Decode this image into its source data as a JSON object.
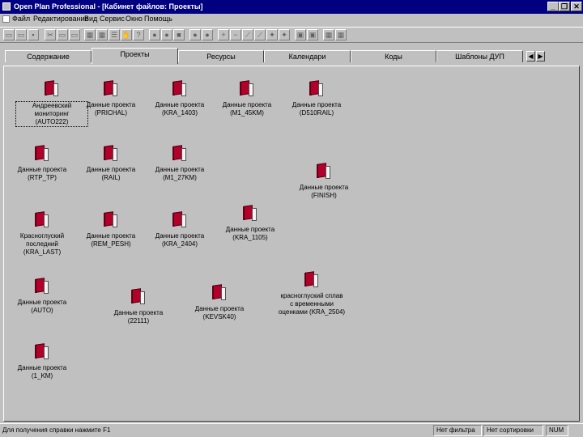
{
  "window": {
    "title": "Open Plan Professional - [Кабинет файлов: Проекты]",
    "minimize_glyph": "_",
    "restore_glyph": "❐",
    "close_glyph": "✕"
  },
  "menu": [
    {
      "label": "Файл"
    },
    {
      "label": "Редактирование"
    },
    {
      "label": "Вид"
    },
    {
      "label": "Сервис"
    },
    {
      "label": "Окно"
    },
    {
      "label": "Помощь"
    }
  ],
  "tabs": [
    {
      "label": "Содержание"
    },
    {
      "label": "Проекты",
      "active": true
    },
    {
      "label": "Ресурсы"
    },
    {
      "label": "Календари"
    },
    {
      "label": "Коды"
    },
    {
      "label": "Шаблоны ДУП"
    }
  ],
  "tab_scroll": {
    "left": "◀",
    "right": "▶"
  },
  "projects": [
    {
      "label": "Андреевский\nмониторинг (AUTO222)",
      "selected": true
    },
    {
      "label": "Данные проекта\n(PRICHAL)"
    },
    {
      "label": "Данные проекта\n(KRA_1403)"
    },
    {
      "label": "Данные проекта\n(M1_45KM)"
    },
    {
      "label": "Данные проекта\n(D510RAIL)"
    },
    {
      "label": "Данные проекта\n(RTP_TP)"
    },
    {
      "label": "Данные проекта\n(RAIL)"
    },
    {
      "label": "Данные проекта\n(M1_27KM)"
    },
    {
      "label": "Данные проекта\n(FINISH)"
    },
    {
      "label": "Красноглуский\nпоследний\n(KRA_LAST)"
    },
    {
      "label": "Данные проекта\n(REM_PESH)"
    },
    {
      "label": "Данные проекта\n(KRA_2404)"
    },
    {
      "label": "Данные проекта\n(KRA_1105)"
    },
    {
      "label": "Данные проекта\n(AUTO)"
    },
    {
      "label": "Данные проекта\n(22111)"
    },
    {
      "label": "Данные проекта\n(KEVSK40)"
    },
    {
      "label": "красноглуский сплав\nс временными\nоценками (KRA_2504)"
    },
    {
      "label": "Данные проекта\n(1_KM)"
    }
  ],
  "status": {
    "help": "Для получения справки нажмите F1",
    "filter": "Нет фильтра",
    "sort": "Нет сортировки",
    "num": "NUM"
  }
}
